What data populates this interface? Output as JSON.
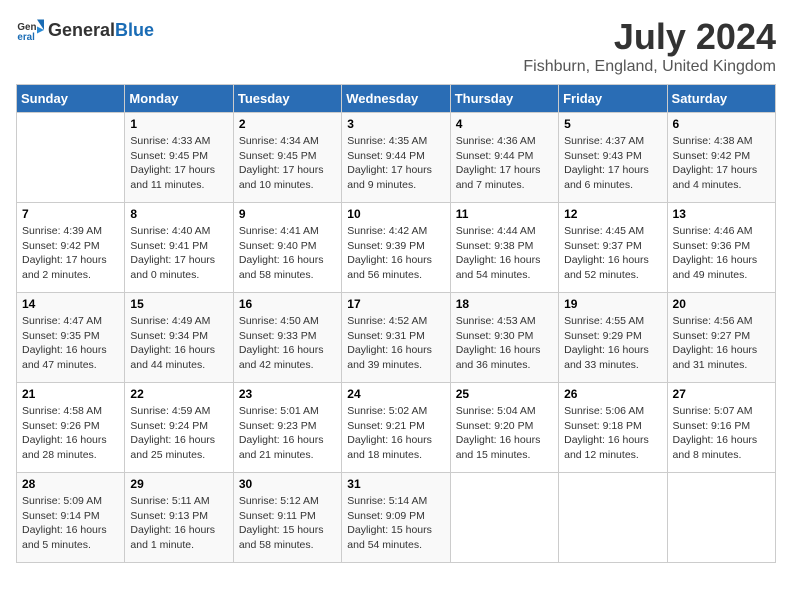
{
  "header": {
    "logo_general": "General",
    "logo_blue": "Blue",
    "month": "July 2024",
    "location": "Fishburn, England, United Kingdom"
  },
  "days_of_week": [
    "Sunday",
    "Monday",
    "Tuesday",
    "Wednesday",
    "Thursday",
    "Friday",
    "Saturday"
  ],
  "weeks": [
    [
      {
        "day": "",
        "content": ""
      },
      {
        "day": "1",
        "content": "Sunrise: 4:33 AM\nSunset: 9:45 PM\nDaylight: 17 hours\nand 11 minutes."
      },
      {
        "day": "2",
        "content": "Sunrise: 4:34 AM\nSunset: 9:45 PM\nDaylight: 17 hours\nand 10 minutes."
      },
      {
        "day": "3",
        "content": "Sunrise: 4:35 AM\nSunset: 9:44 PM\nDaylight: 17 hours\nand 9 minutes."
      },
      {
        "day": "4",
        "content": "Sunrise: 4:36 AM\nSunset: 9:44 PM\nDaylight: 17 hours\nand 7 minutes."
      },
      {
        "day": "5",
        "content": "Sunrise: 4:37 AM\nSunset: 9:43 PM\nDaylight: 17 hours\nand 6 minutes."
      },
      {
        "day": "6",
        "content": "Sunrise: 4:38 AM\nSunset: 9:42 PM\nDaylight: 17 hours\nand 4 minutes."
      }
    ],
    [
      {
        "day": "7",
        "content": "Sunrise: 4:39 AM\nSunset: 9:42 PM\nDaylight: 17 hours\nand 2 minutes."
      },
      {
        "day": "8",
        "content": "Sunrise: 4:40 AM\nSunset: 9:41 PM\nDaylight: 17 hours\nand 0 minutes."
      },
      {
        "day": "9",
        "content": "Sunrise: 4:41 AM\nSunset: 9:40 PM\nDaylight: 16 hours\nand 58 minutes."
      },
      {
        "day": "10",
        "content": "Sunrise: 4:42 AM\nSunset: 9:39 PM\nDaylight: 16 hours\nand 56 minutes."
      },
      {
        "day": "11",
        "content": "Sunrise: 4:44 AM\nSunset: 9:38 PM\nDaylight: 16 hours\nand 54 minutes."
      },
      {
        "day": "12",
        "content": "Sunrise: 4:45 AM\nSunset: 9:37 PM\nDaylight: 16 hours\nand 52 minutes."
      },
      {
        "day": "13",
        "content": "Sunrise: 4:46 AM\nSunset: 9:36 PM\nDaylight: 16 hours\nand 49 minutes."
      }
    ],
    [
      {
        "day": "14",
        "content": "Sunrise: 4:47 AM\nSunset: 9:35 PM\nDaylight: 16 hours\nand 47 minutes."
      },
      {
        "day": "15",
        "content": "Sunrise: 4:49 AM\nSunset: 9:34 PM\nDaylight: 16 hours\nand 44 minutes."
      },
      {
        "day": "16",
        "content": "Sunrise: 4:50 AM\nSunset: 9:33 PM\nDaylight: 16 hours\nand 42 minutes."
      },
      {
        "day": "17",
        "content": "Sunrise: 4:52 AM\nSunset: 9:31 PM\nDaylight: 16 hours\nand 39 minutes."
      },
      {
        "day": "18",
        "content": "Sunrise: 4:53 AM\nSunset: 9:30 PM\nDaylight: 16 hours\nand 36 minutes."
      },
      {
        "day": "19",
        "content": "Sunrise: 4:55 AM\nSunset: 9:29 PM\nDaylight: 16 hours\nand 33 minutes."
      },
      {
        "day": "20",
        "content": "Sunrise: 4:56 AM\nSunset: 9:27 PM\nDaylight: 16 hours\nand 31 minutes."
      }
    ],
    [
      {
        "day": "21",
        "content": "Sunrise: 4:58 AM\nSunset: 9:26 PM\nDaylight: 16 hours\nand 28 minutes."
      },
      {
        "day": "22",
        "content": "Sunrise: 4:59 AM\nSunset: 9:24 PM\nDaylight: 16 hours\nand 25 minutes."
      },
      {
        "day": "23",
        "content": "Sunrise: 5:01 AM\nSunset: 9:23 PM\nDaylight: 16 hours\nand 21 minutes."
      },
      {
        "day": "24",
        "content": "Sunrise: 5:02 AM\nSunset: 9:21 PM\nDaylight: 16 hours\nand 18 minutes."
      },
      {
        "day": "25",
        "content": "Sunrise: 5:04 AM\nSunset: 9:20 PM\nDaylight: 16 hours\nand 15 minutes."
      },
      {
        "day": "26",
        "content": "Sunrise: 5:06 AM\nSunset: 9:18 PM\nDaylight: 16 hours\nand 12 minutes."
      },
      {
        "day": "27",
        "content": "Sunrise: 5:07 AM\nSunset: 9:16 PM\nDaylight: 16 hours\nand 8 minutes."
      }
    ],
    [
      {
        "day": "28",
        "content": "Sunrise: 5:09 AM\nSunset: 9:14 PM\nDaylight: 16 hours\nand 5 minutes."
      },
      {
        "day": "29",
        "content": "Sunrise: 5:11 AM\nSunset: 9:13 PM\nDaylight: 16 hours\nand 1 minute."
      },
      {
        "day": "30",
        "content": "Sunrise: 5:12 AM\nSunset: 9:11 PM\nDaylight: 15 hours\nand 58 minutes."
      },
      {
        "day": "31",
        "content": "Sunrise: 5:14 AM\nSunset: 9:09 PM\nDaylight: 15 hours\nand 54 minutes."
      },
      {
        "day": "",
        "content": ""
      },
      {
        "day": "",
        "content": ""
      },
      {
        "day": "",
        "content": ""
      }
    ]
  ]
}
